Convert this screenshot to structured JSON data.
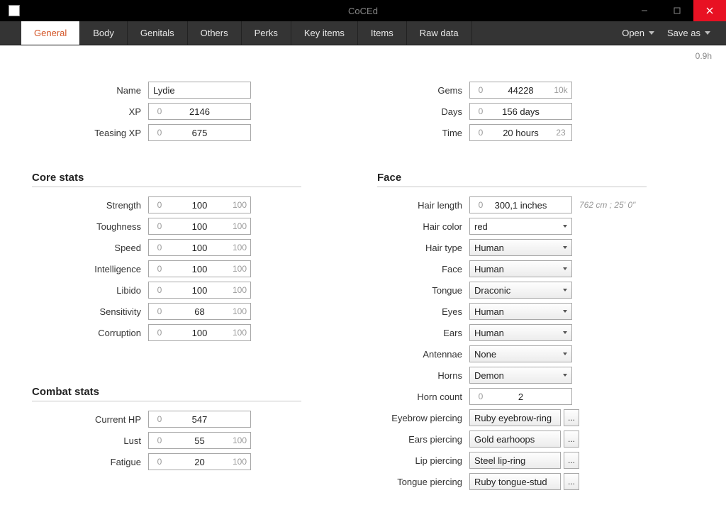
{
  "app": {
    "title": "CoCEd",
    "version": "0.9h"
  },
  "tabs": [
    "General",
    "Body",
    "Genitals",
    "Others",
    "Perks",
    "Key items",
    "Items",
    "Raw data"
  ],
  "active_tab": 0,
  "menu": {
    "open": "Open",
    "save_as": "Save as"
  },
  "left": {
    "basic": {
      "name_label": "Name",
      "name_value": "Lydie",
      "xp_label": "XP",
      "xp": {
        "lo": "0",
        "val": "2146",
        "hi": ""
      },
      "teasing_label": "Teasing XP",
      "teasing": {
        "lo": "0",
        "val": "675",
        "hi": ""
      }
    },
    "core_title": "Core stats",
    "core": [
      {
        "label": "Strength",
        "lo": "0",
        "val": "100",
        "hi": "100"
      },
      {
        "label": "Toughness",
        "lo": "0",
        "val": "100",
        "hi": "100"
      },
      {
        "label": "Speed",
        "lo": "0",
        "val": "100",
        "hi": "100"
      },
      {
        "label": "Intelligence",
        "lo": "0",
        "val": "100",
        "hi": "100"
      },
      {
        "label": "Libido",
        "lo": "0",
        "val": "100",
        "hi": "100"
      },
      {
        "label": "Sensitivity",
        "lo": "0",
        "val": "68",
        "hi": "100"
      },
      {
        "label": "Corruption",
        "lo": "0",
        "val": "100",
        "hi": "100"
      }
    ],
    "combat_title": "Combat stats",
    "combat": [
      {
        "label": "Current HP",
        "lo": "0",
        "val": "547",
        "hi": ""
      },
      {
        "label": "Lust",
        "lo": "0",
        "val": "55",
        "hi": "100"
      },
      {
        "label": "Fatigue",
        "lo": "0",
        "val": "20",
        "hi": "100"
      }
    ]
  },
  "right": {
    "basic": {
      "gems_label": "Gems",
      "gems": {
        "lo": "0",
        "val": "44228",
        "hi": "10k"
      },
      "days_label": "Days",
      "days": {
        "lo": "0",
        "val": "156 days",
        "hi": ""
      },
      "time_label": "Time",
      "time": {
        "lo": "0",
        "val": "20 hours",
        "hi": "23"
      }
    },
    "face_title": "Face",
    "hair_length_label": "Hair length",
    "hair_length": {
      "lo": "0",
      "val": "300,1 inches",
      "hi": ""
    },
    "hair_length_hint": "762 cm ; 25' 0\"",
    "hair_color_label": "Hair color",
    "hair_color": "red",
    "hair_type_label": "Hair type",
    "hair_type": "Human",
    "face_label": "Face",
    "face": "Human",
    "tongue_label": "Tongue",
    "tongue": "Draconic",
    "eyes_label": "Eyes",
    "eyes": "Human",
    "ears_label": "Ears",
    "ears": "Human",
    "antennae_label": "Antennae",
    "antennae": "None",
    "horns_label": "Horns",
    "horns": "Demon",
    "horn_count_label": "Horn count",
    "horn_count": {
      "lo": "0",
      "val": "2",
      "hi": ""
    },
    "eyebrow_label": "Eyebrow piercing",
    "eyebrow": "Ruby eyebrow-ring",
    "ears_p_label": "Ears piercing",
    "ears_p": "Gold earhoops",
    "lip_label": "Lip piercing",
    "lip": "Steel lip-ring",
    "tongue_p_label": "Tongue piercing",
    "tongue_p": "Ruby tongue-stud",
    "dots": "..."
  }
}
